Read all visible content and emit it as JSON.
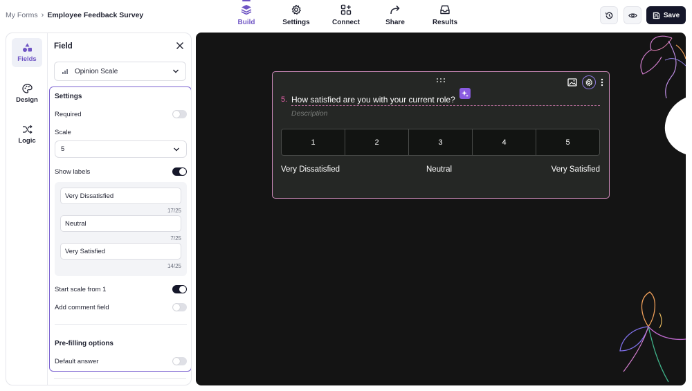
{
  "breadcrumb": {
    "root": "My Forms",
    "current": "Employee Feedback Survey"
  },
  "nav": {
    "tabs": [
      {
        "label": "Build",
        "icon": "stack-icon",
        "active": true
      },
      {
        "label": "Settings",
        "icon": "gear-icon",
        "active": false
      },
      {
        "label": "Connect",
        "icon": "connect-icon",
        "active": false
      },
      {
        "label": "Share",
        "icon": "share-arrow-icon",
        "active": false
      },
      {
        "label": "Results",
        "icon": "inbox-icon",
        "active": false
      }
    ]
  },
  "header_actions": {
    "history_icon": "history-icon",
    "preview_icon": "eye-icon",
    "save_label": "Save"
  },
  "sidebar": {
    "items": [
      {
        "label": "Fields",
        "icon": "shapes-icon",
        "active": true
      },
      {
        "label": "Design",
        "icon": "palette-icon",
        "active": false
      },
      {
        "label": "Logic",
        "icon": "shuffle-icon",
        "active": false
      }
    ]
  },
  "field_panel": {
    "title": "Field",
    "field_type": "Opinion Scale",
    "settings": {
      "heading": "Settings",
      "required_label": "Required",
      "required": false,
      "scale_label": "Scale",
      "scale_value": "5",
      "show_labels_label": "Show labels",
      "show_labels": true,
      "labels": [
        {
          "value": "Very Dissatisfied",
          "counter": "17/25"
        },
        {
          "value": "Neutral",
          "counter": "7/25"
        },
        {
          "value": "Very Satisfied",
          "counter": "14/25"
        }
      ],
      "start_from_one_label": "Start scale from 1",
      "start_from_one": true,
      "comment_field_label": "Add comment field",
      "comment_field": false,
      "prefill_heading": "Pre-filling options",
      "default_answer_label": "Default answer",
      "default_answer": false
    }
  },
  "question": {
    "number": "5.",
    "text": "How satisfied are you with your current role?",
    "description_placeholder": "Description",
    "scale_options": [
      "1",
      "2",
      "3",
      "4",
      "5"
    ],
    "label_left": "Very Dissatisfied",
    "label_center": "Neutral",
    "label_right": "Very Satisfied"
  },
  "colors": {
    "accent": "#6f55c4",
    "dark": "#15172a",
    "canvas": "#141414",
    "card_border": "#d48fc0",
    "question_number": "#e15fa6"
  }
}
